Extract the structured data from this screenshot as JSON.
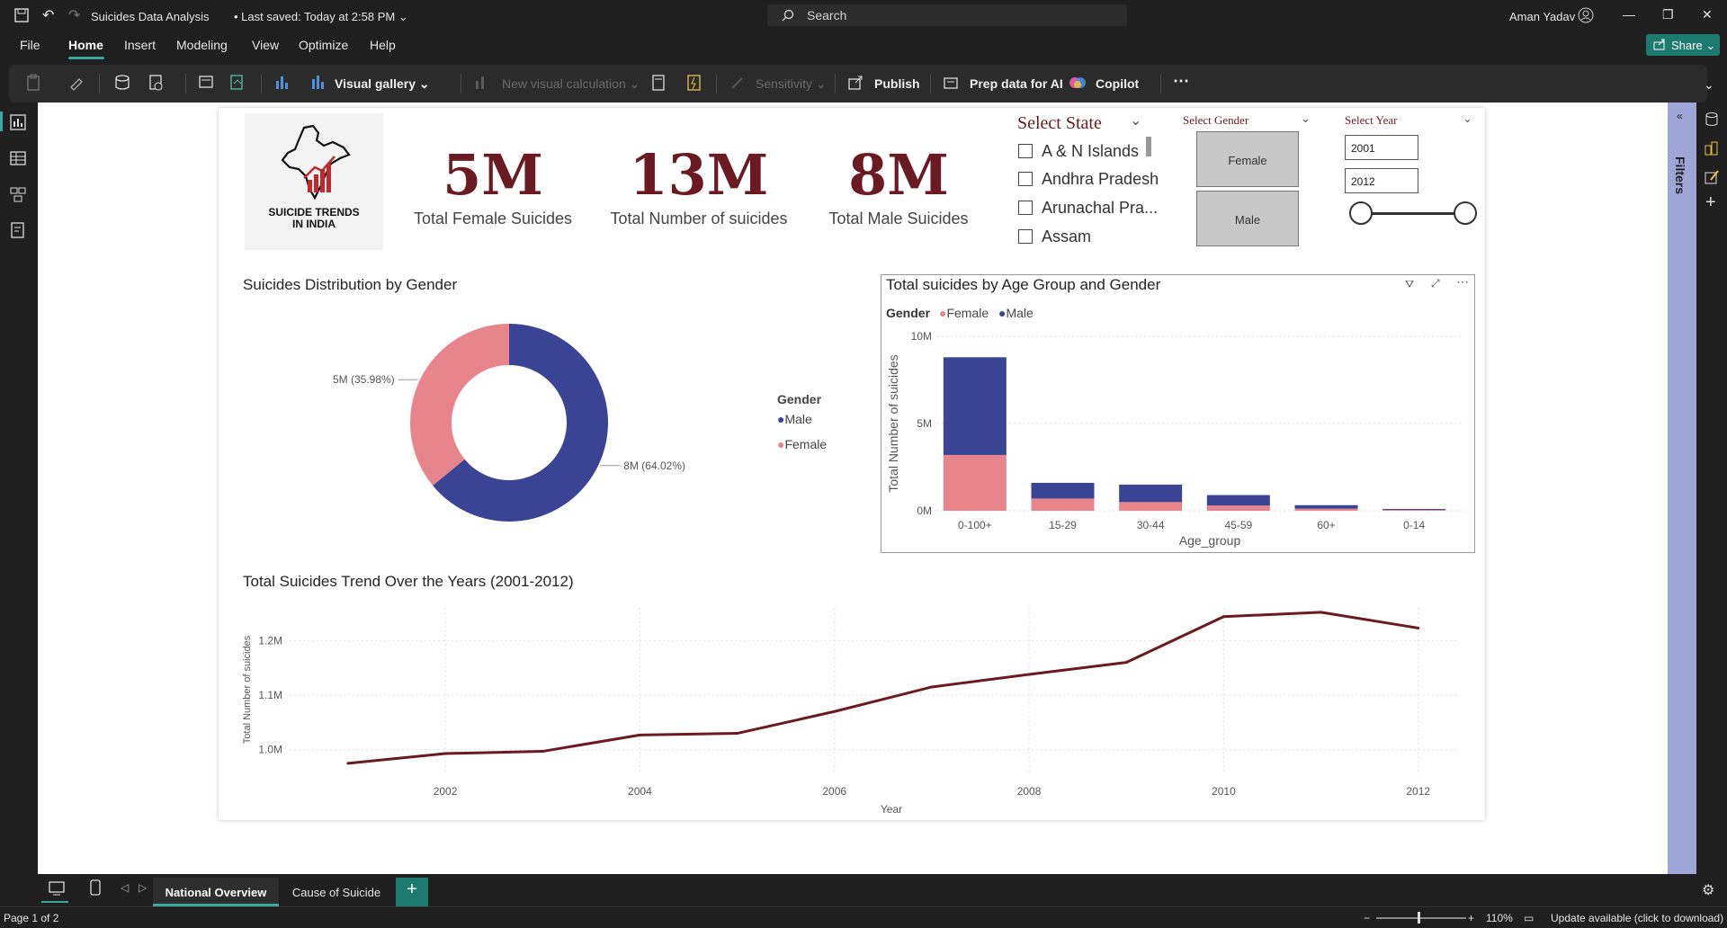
{
  "titlebar": {
    "doc_title": "Suicides Data Analysis",
    "saved": "Last saved: Today at 2:58 PM",
    "search_placeholder": "Search",
    "user": "Aman Yadav"
  },
  "menu": [
    "File",
    "Home",
    "Insert",
    "Modeling",
    "View",
    "Optimize",
    "Help"
  ],
  "share_label": "Share",
  "ribbon": {
    "visual_gallery": "Visual gallery",
    "new_visual_calc": "New visual calculation",
    "sensitivity": "Sensitivity",
    "publish": "Publish",
    "prep_ai": "Prep data for AI",
    "copilot": "Copilot"
  },
  "colors": {
    "female": "#e8858c",
    "male": "#3a4394",
    "kpi": "#6b1a22",
    "line": "#6b1a22",
    "accent": "#3aa9a0"
  },
  "logo": {
    "line1": "SUICIDE TRENDS",
    "line2": "IN INDIA"
  },
  "kpis": [
    {
      "value": "5M",
      "label": "Total Female Suicides"
    },
    {
      "value": "13M",
      "label": "Total Number of suicides"
    },
    {
      "value": "8M",
      "label": "Total Male Suicides"
    }
  ],
  "state_slicer": {
    "title": "Select State",
    "items": [
      "A & N Islands",
      "Andhra Pradesh",
      "Arunachal Pra...",
      "Assam"
    ]
  },
  "gender_slicer": {
    "title": "Select Gender",
    "options": [
      "Female",
      "Male"
    ]
  },
  "year_slicer": {
    "title": "Select Year",
    "from": "2001",
    "to": "2012"
  },
  "donut": {
    "title": "Suicides Distribution by Gender",
    "legend_title": "Gender",
    "legend": [
      "Male",
      "Female"
    ],
    "female_label": "5M (35.98%)",
    "male_label": "8M (64.02%)"
  },
  "bar": {
    "title": "Total suicides by Age Group and Gender",
    "legend_title": "Gender",
    "legend": [
      "Female",
      "Male"
    ],
    "ylabel": "Total Number of suicides",
    "xlabel": "Age_group",
    "yticks": [
      "10M",
      "5M",
      "0M"
    ]
  },
  "line": {
    "title": "Total Suicides Trend Over the Years (2001-2012)",
    "ylabel": "Total Number of suicides",
    "xlabel": "Year",
    "yticks": [
      "1.2M",
      "1.1M",
      "1.0M"
    ],
    "xticks": [
      "2002",
      "2004",
      "2006",
      "2008",
      "2010",
      "2012"
    ]
  },
  "pages": [
    "National Overview",
    "Cause of Suicide"
  ],
  "status": {
    "page": "Page 1 of 2",
    "zoom": "110%",
    "update": "Update available (click to download)"
  },
  "filters_label": "Filters",
  "chart_data": [
    {
      "type": "pie",
      "title": "Suicides Distribution by Gender",
      "categories": [
        "Female",
        "Male"
      ],
      "values": [
        35.98,
        64.02
      ],
      "labels": [
        "5M (35.98%)",
        "8M (64.02%)"
      ]
    },
    {
      "type": "bar",
      "title": "Total suicides by Age Group and Gender",
      "categories": [
        "0-100+",
        "15-29",
        "30-44",
        "45-59",
        "60+",
        "0-14"
      ],
      "series": [
        {
          "name": "Female",
          "values": [
            3.2,
            0.7,
            0.5,
            0.3,
            0.12,
            0.05
          ]
        },
        {
          "name": "Male",
          "values": [
            5.6,
            0.9,
            1.0,
            0.6,
            0.2,
            0.05
          ]
        }
      ],
      "ylim": [
        0,
        10
      ],
      "unit": "M"
    },
    {
      "type": "line",
      "title": "Total Suicides Trend Over the Years (2001-2012)",
      "x": [
        2001,
        2002,
        2003,
        2004,
        2005,
        2006,
        2007,
        2008,
        2009,
        2010,
        2011,
        2012
      ],
      "y": [
        0.975,
        0.993,
        0.997,
        1.027,
        1.03,
        1.07,
        1.115,
        1.138,
        1.16,
        1.244,
        1.252,
        1.223
      ],
      "ylim": [
        0.96,
        1.26
      ],
      "unit": "M"
    }
  ]
}
